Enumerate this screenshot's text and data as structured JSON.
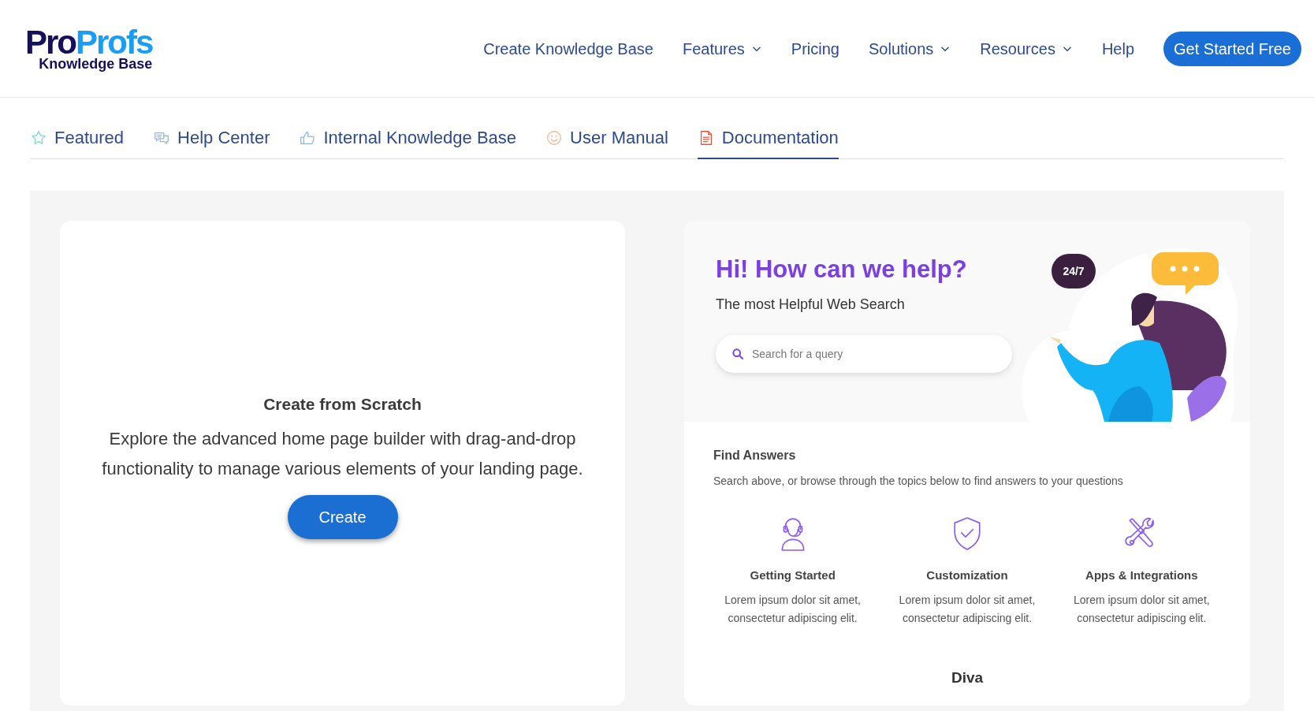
{
  "logo": {
    "parts": [
      {
        "text": "Pro",
        "color": "#15105e"
      },
      {
        "text": "Profs",
        "color": "#1a9ef5"
      }
    ],
    "tagline": "Knowledge Base"
  },
  "nav": [
    {
      "label": "Create Knowledge Base",
      "dropdown": false
    },
    {
      "label": "Features",
      "dropdown": true
    },
    {
      "label": "Pricing",
      "dropdown": false
    },
    {
      "label": "Solutions",
      "dropdown": true
    },
    {
      "label": "Resources",
      "dropdown": true
    },
    {
      "label": "Help",
      "dropdown": false
    }
  ],
  "cta": "Get Started Free",
  "tabs": [
    {
      "label": "Featured",
      "kind": "star",
      "selected": false
    },
    {
      "label": "Help Center",
      "kind": "chat",
      "selected": false
    },
    {
      "label": "Internal Knowledge Base",
      "kind": "thumb",
      "selected": false
    },
    {
      "label": "User Manual",
      "kind": "smile",
      "selected": false
    },
    {
      "label": "Documentation",
      "kind": "doc",
      "selected": true
    }
  ],
  "scratch": {
    "title": "Create from Scratch",
    "description": "Explore the advanced home page builder with drag-and-drop functionality to manage various elements of your landing page.",
    "button": "Create"
  },
  "preview": {
    "heading": "Hi! How can we help?",
    "subheading": "The most Helpful Web Search",
    "search_placeholder": "Search for a query",
    "bubble": "24/7",
    "section_title": "Find Answers",
    "section_text": "Search above, or browse through the topics below to find answers to your questions",
    "topics": [
      {
        "kind": "headset",
        "title": "Getting Started",
        "text": "Lorem ipsum dolor sit amet, consectetur adipiscing elit."
      },
      {
        "kind": "shield",
        "title": "Customization",
        "text": "Lorem ipsum dolor sit amet, consectetur adipiscing elit."
      },
      {
        "kind": "tools",
        "title": "Apps & Integrations",
        "text": "Lorem ipsum dolor sit amet, consectetur adipiscing elit."
      }
    ],
    "template_name": "Diva"
  }
}
